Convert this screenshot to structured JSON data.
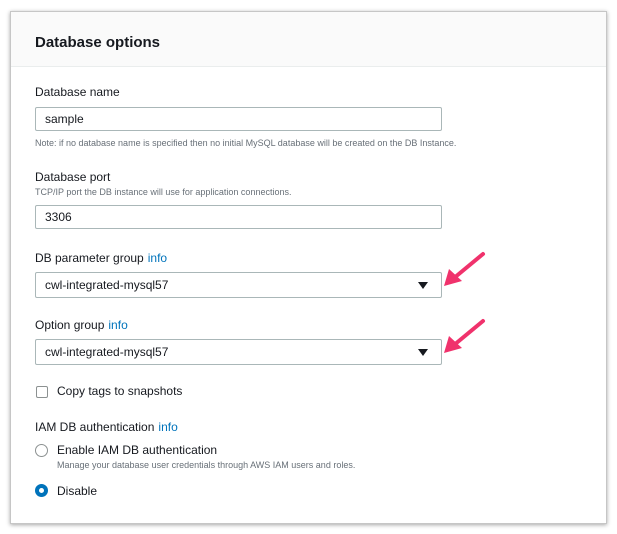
{
  "panel": {
    "title": "Database options"
  },
  "database_name": {
    "label": "Database name",
    "value": "sample",
    "note": "Note: if no database name is specified then no initial MySQL database will be created on the DB Instance."
  },
  "database_port": {
    "label": "Database port",
    "description": "TCP/IP port the DB instance will use for application connections.",
    "value": "3306"
  },
  "db_parameter_group": {
    "label": "DB parameter group",
    "info_label": "info",
    "selected": "cwl-integrated-mysql57"
  },
  "option_group": {
    "label": "Option group",
    "info_label": "info",
    "selected": "cwl-integrated-mysql57"
  },
  "copy_tags": {
    "label": "Copy tags to snapshots",
    "checked": false
  },
  "iam_auth": {
    "label": "IAM DB authentication",
    "info_label": "info",
    "options": [
      {
        "label": "Enable IAM DB authentication",
        "description": "Manage your database user credentials through AWS IAM users and roles.",
        "selected": false
      },
      {
        "label": "Disable",
        "selected": true
      }
    ]
  },
  "colors": {
    "accent": "#0073bb",
    "annotation_arrow": "#f0326c"
  }
}
